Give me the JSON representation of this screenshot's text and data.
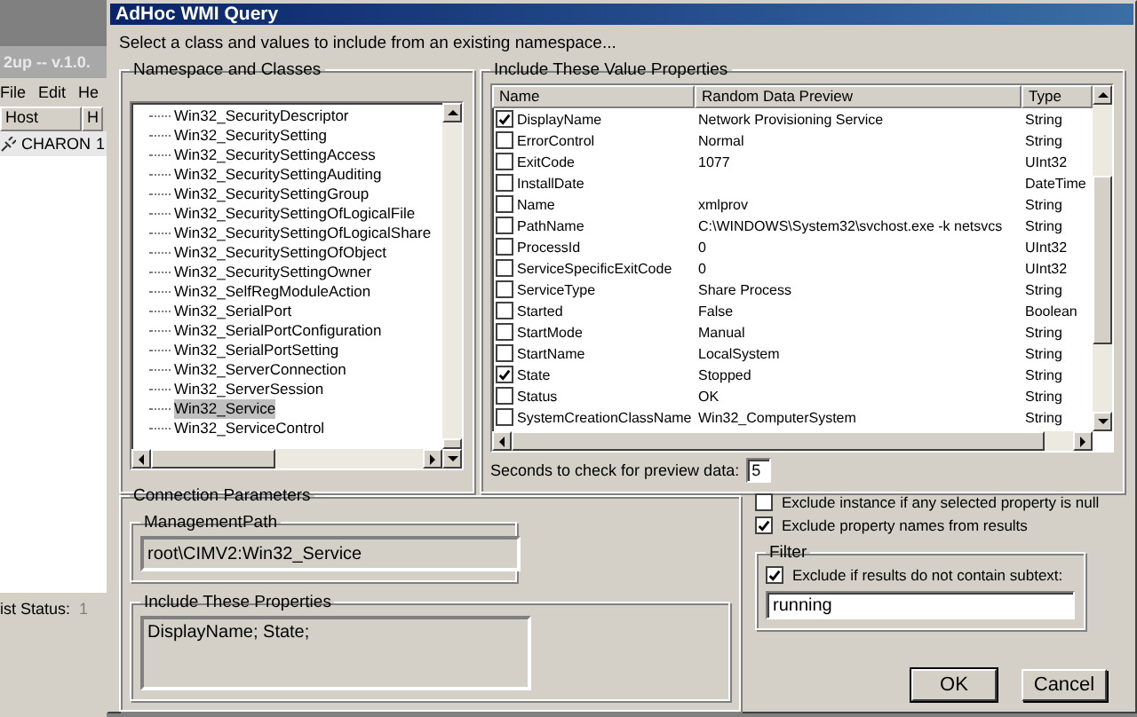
{
  "background_window": {
    "title": "2up -- v.1.0.",
    "menu": [
      "File",
      "Edit",
      "He"
    ],
    "columns": [
      "Host",
      "H"
    ],
    "rows": [
      [
        "CHARON",
        "1"
      ]
    ],
    "status_label": "ist Status:",
    "status_value": "1"
  },
  "dialog": {
    "title": "AdHoc WMI Query",
    "instruction": "Select a class and values to include from an existing namespace...",
    "namespace": {
      "title": "Namespace and Classes",
      "classes": [
        {
          "label": "Win32_SecurityDescriptor",
          "selected": false
        },
        {
          "label": "Win32_SecuritySetting",
          "selected": false
        },
        {
          "label": "Win32_SecuritySettingAccess",
          "selected": false
        },
        {
          "label": "Win32_SecuritySettingAuditing",
          "selected": false
        },
        {
          "label": "Win32_SecuritySettingGroup",
          "selected": false
        },
        {
          "label": "Win32_SecuritySettingOfLogicalFile",
          "selected": false
        },
        {
          "label": "Win32_SecuritySettingOfLogicalShare",
          "selected": false
        },
        {
          "label": "Win32_SecuritySettingOfObject",
          "selected": false
        },
        {
          "label": "Win32_SecuritySettingOwner",
          "selected": false
        },
        {
          "label": "Win32_SelfRegModuleAction",
          "selected": false
        },
        {
          "label": "Win32_SerialPort",
          "selected": false
        },
        {
          "label": "Win32_SerialPortConfiguration",
          "selected": false
        },
        {
          "label": "Win32_SerialPortSetting",
          "selected": false
        },
        {
          "label": "Win32_ServerConnection",
          "selected": false
        },
        {
          "label": "Win32_ServerSession",
          "selected": false
        },
        {
          "label": "Win32_Service",
          "selected": true
        },
        {
          "label": "Win32_ServiceControl",
          "selected": false
        }
      ]
    },
    "value_properties": {
      "title": "Include These Value Properties",
      "columns": [
        "Name",
        "Random Data Preview",
        "Type"
      ],
      "rows": [
        {
          "name": "DisplayName",
          "preview": "Network Provisioning Service",
          "type": "String",
          "checked": true
        },
        {
          "name": "ErrorControl",
          "preview": "Normal",
          "type": "String",
          "checked": false
        },
        {
          "name": "ExitCode",
          "preview": "1077",
          "type": "UInt32",
          "checked": false
        },
        {
          "name": "InstallDate",
          "preview": "",
          "type": "DateTime",
          "checked": false
        },
        {
          "name": "Name",
          "preview": "xmlprov",
          "type": "String",
          "checked": false
        },
        {
          "name": "PathName",
          "preview": "C:\\WINDOWS\\System32\\svchost.exe -k netsvcs",
          "type": "String",
          "checked": false
        },
        {
          "name": "ProcessId",
          "preview": "0",
          "type": "UInt32",
          "checked": false
        },
        {
          "name": "ServiceSpecificExitCode",
          "preview": "0",
          "type": "UInt32",
          "checked": false
        },
        {
          "name": "ServiceType",
          "preview": "Share Process",
          "type": "String",
          "checked": false
        },
        {
          "name": "Started",
          "preview": "False",
          "type": "Boolean",
          "checked": false
        },
        {
          "name": "StartMode",
          "preview": "Manual",
          "type": "String",
          "checked": false
        },
        {
          "name": "StartName",
          "preview": "LocalSystem",
          "type": "String",
          "checked": false
        },
        {
          "name": "State",
          "preview": "Stopped",
          "type": "String",
          "checked": true
        },
        {
          "name": "Status",
          "preview": "OK",
          "type": "String",
          "checked": false
        },
        {
          "name": "SystemCreationClassName",
          "preview": "Win32_ComputerSystem",
          "type": "String",
          "checked": false
        }
      ],
      "seconds_label": "Seconds to check for preview data:",
      "seconds_value": "5"
    },
    "connection": {
      "title": "Connection Parameters",
      "path_title": "ManagementPath",
      "path_value": "root\\CIMV2:Win32_Service",
      "properties_title": "Include These Properties",
      "properties_value": "DisplayName; State;"
    },
    "options": [
      {
        "label": "Exclude instance if any selected property is null",
        "checked": false
      },
      {
        "label": "Exclude property names from results",
        "checked": true
      }
    ],
    "filter": {
      "title": "Filter",
      "option": {
        "label": "Exclude if results do not contain subtext:",
        "checked": true
      },
      "value": "running"
    },
    "buttons": [
      "OK",
      "Cancel"
    ]
  }
}
